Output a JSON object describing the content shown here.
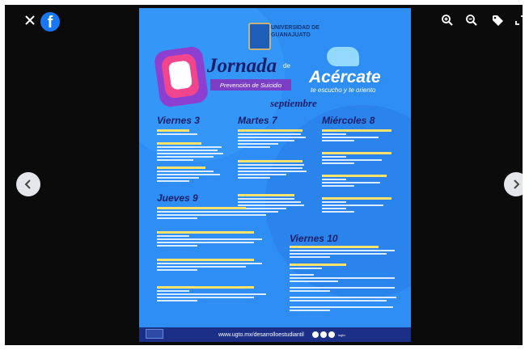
{
  "viewer": {
    "close_icon": "close-icon",
    "brand_icon": "facebook-icon",
    "brand_letter": "f",
    "toolbar": [
      "zoom-in-icon",
      "zoom-out-icon",
      "tag-icon",
      "fullscreen-icon"
    ],
    "nav": {
      "prev_icon": "chevron-left-icon",
      "next_icon": "chevron-right-icon"
    }
  },
  "poster": {
    "university": [
      "UNIVERSIDAD DE",
      "GUANAJUATO"
    ],
    "title_main": "Jornada",
    "title_de": "de",
    "subtitle": "Prevención de Suicidio",
    "month": "septiembre",
    "acercate": "Acércate",
    "acercate_sub": "te escucho y te oriento",
    "days": {
      "viernes3": "Viernes 3",
      "martes7": "Martes 7",
      "miercoles8": "Miércoles 8",
      "jueves9": "Jueves 9",
      "viernes10": "Viernes 10"
    },
    "footer_url": "www.ugto.mx/desarrolloestudiantil",
    "footer_small": "/ugto"
  }
}
